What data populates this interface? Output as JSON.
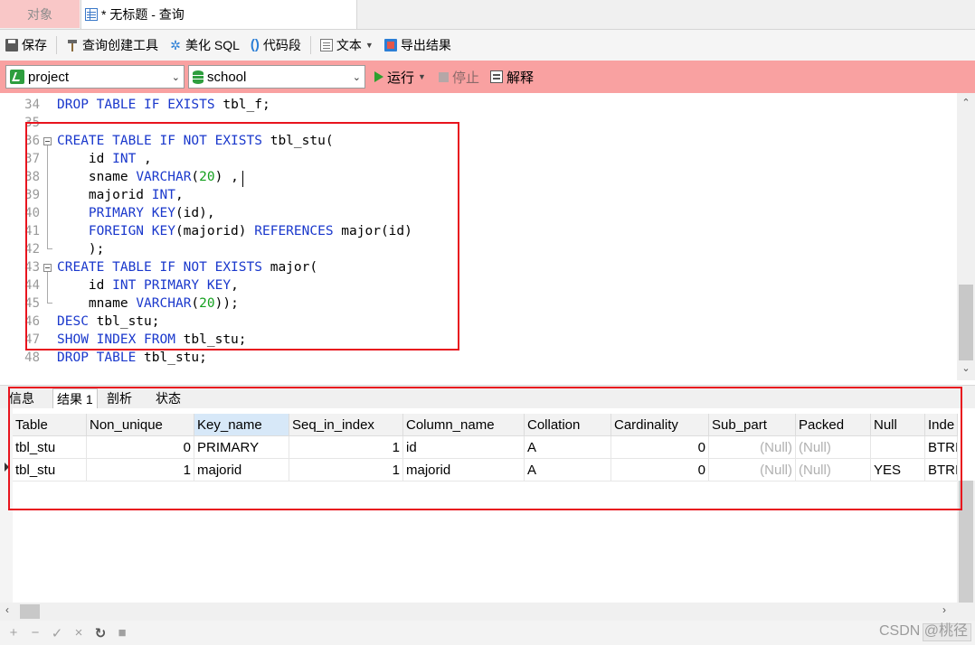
{
  "tabs": {
    "objects": "对象",
    "query": "* 无标题 - 查询"
  },
  "toolbar": {
    "save": "保存",
    "query_builder": "查询创建工具",
    "beautify_sql": "美化 SQL",
    "code_snippet": "代码段",
    "text": "文本",
    "export": "导出结果"
  },
  "connection": {
    "project": "project",
    "database": "school",
    "run": "运行",
    "stop": "停止",
    "explain": "解释"
  },
  "editor": {
    "line_numbers": [
      "34",
      "35",
      "36",
      "37",
      "38",
      "39",
      "40",
      "41",
      "42",
      "43",
      "44",
      "45",
      "46",
      "47",
      "48"
    ]
  },
  "result_tabs": [
    "信息",
    "结果 1",
    "剖析",
    "状态"
  ],
  "grid": {
    "columns": [
      "Table",
      "Non_unique",
      "Key_name",
      "Seq_in_index",
      "Column_name",
      "Collation",
      "Cardinality",
      "Sub_part",
      "Packed",
      "Null",
      "Inde"
    ],
    "rows": [
      [
        "tbl_stu",
        "0",
        "PRIMARY",
        "1",
        "id",
        "A",
        "0",
        "(Null)",
        "(Null)",
        "",
        "BTRI"
      ],
      [
        "tbl_stu",
        "1",
        "majorid",
        "1",
        "majorid",
        "A",
        "0",
        "(Null)",
        "(Null)",
        "YES",
        "BTRI"
      ]
    ]
  },
  "bottom_buttons": [
    "+",
    "−",
    "✓",
    "×",
    "↻",
    "■"
  ],
  "watermark": "CSDN @桃径",
  "colors": {
    "connection_bar": "#f9a1a1",
    "highlight_box": "#e8141e",
    "keyword": "#1a38cc",
    "number": "#14a01e"
  }
}
